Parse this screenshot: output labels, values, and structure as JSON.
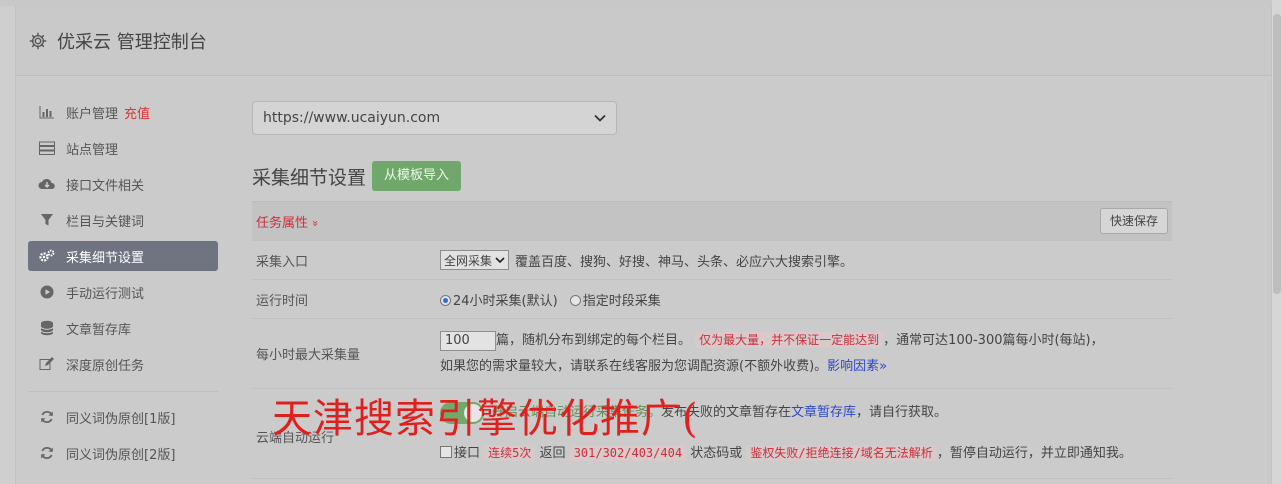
{
  "header": {
    "title": "优采云 管理控制台",
    "icon": "gear-icon"
  },
  "sidebar": {
    "items": [
      {
        "label": "账户管理",
        "badge": "充值",
        "icon": "bar-chart-icon"
      },
      {
        "label": "站点管理",
        "icon": "server-icon"
      },
      {
        "label": "接口文件相关",
        "icon": "cloud-download-icon"
      },
      {
        "label": "栏目与关键词",
        "icon": "filter-icon"
      },
      {
        "label": "采集细节设置",
        "icon": "cogs-icon",
        "active": true
      },
      {
        "label": "手动运行测试",
        "icon": "play-circle-icon"
      },
      {
        "label": "文章暂存库",
        "icon": "database-icon"
      },
      {
        "label": "深度原创任务",
        "icon": "edit-icon"
      },
      {
        "label": "同义词伪原创[1版]",
        "icon": "refresh-icon"
      },
      {
        "label": "同义词伪原创[2版]",
        "icon": "refresh-icon"
      }
    ]
  },
  "main": {
    "site_select": "https://www.ucaiyun.com",
    "section_title": "采集细节设置",
    "import_button": "从模板导入",
    "task_props_label": "任务属性",
    "task_props_chevron": "»",
    "quick_save": "快速保存",
    "rows": {
      "entry": {
        "label": "采集入口",
        "select": "全网采集",
        "desc": "覆盖百度、搜狗、好搜、神马、头条、必应六大搜索引擎。"
      },
      "time": {
        "label": "运行时间",
        "opt1": "24小时采集(默认)",
        "opt2": "指定时段采集"
      },
      "max": {
        "label": "每小时最大采集量",
        "value": "100",
        "text1": "篇，随机分布到绑定的每个栏目。",
        "warn": "仅为最大量，并不保证一定能达到",
        "text2": "，通常可达100-300篇每小时(每站)，",
        "text3": "如果您的需求量较大，请联系在线客服为您调配资源(不额外收费)。",
        "link": "影响因素»"
      },
      "cloud": {
        "label": "云端自动运行",
        "text1": "开启云端自动运行采集任务。",
        "text2": "发布失败的文章暂存在",
        "link": "文章暂存库",
        "text3": "，请自行获取。",
        "check_label": "接口",
        "c1": "连续5次",
        "t1": "返回",
        "codes": "301/302/403/404",
        "t2": "状态码或",
        "c2": "鉴权失败/拒绝连接/域名无法解析",
        "t3": "，暂停自动运行，并立即通知我。"
      }
    }
  },
  "overlay_text": "天津搜索引擎优化推广("
}
